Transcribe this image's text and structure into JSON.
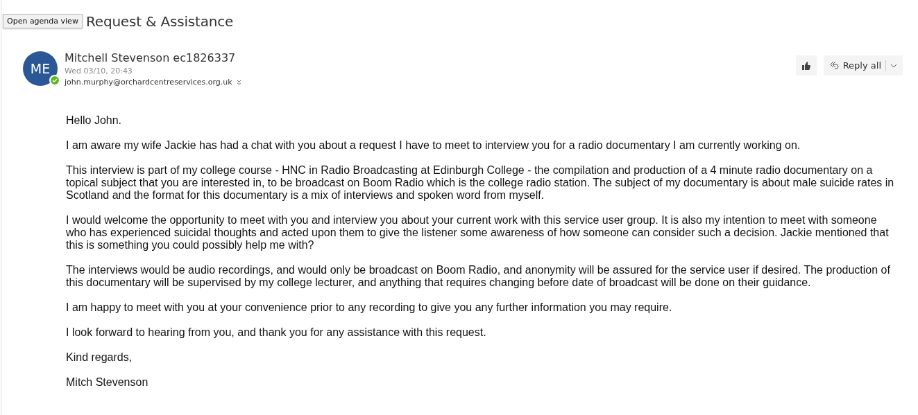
{
  "tooltip": "Open agenda view",
  "subject": "Request & Assistance",
  "sender": {
    "initials": "ME",
    "name": "Mitchell Stevenson ec1826337",
    "date": "Wed 03/10, 20:43",
    "to": "john.murphy@orchardcentreservices.org.uk",
    "online": true
  },
  "actions": {
    "reply_all": "Reply all"
  },
  "body": [
    "Hello John.",
    "I am aware my wife Jackie has had a chat with you about a request I have to meet to interview you for a radio documentary I am currently working on.",
    "This interview is part of my college course - HNC in Radio Broadcasting at Edinburgh College - the compilation and production of a 4 minute radio documentary on a topical subject that you are interested in, to be broadcast on Boom Radio which is the college radio station. The subject of my documentary is about male suicide rates in Scotland and the format for this documentary is a mix of interviews and spoken word from myself.",
    "I would welcome the opportunity to meet with you and interview you about your current work with this service user group. It is also my intention to meet with someone who has experienced suicidal thoughts and acted upon them to give the listener some awareness of how someone can consider such a decision. Jackie mentioned that this is something you could possibly help me with?",
    "The interviews would be audio recordings, and would only be broadcast on Boom Radio, and anonymity will be assured for the service user if desired. The production of this documentary will be supervised by my college lecturer, and anything that requires changing before date of broadcast will be done on their guidance.",
    "I am happy to meet with you at your convenience prior to any recording to give you any further information you may require.",
    "I look forward to hearing from you, and thank you for any assistance with this request.",
    "Kind regards,",
    "Mitch Stevenson"
  ]
}
